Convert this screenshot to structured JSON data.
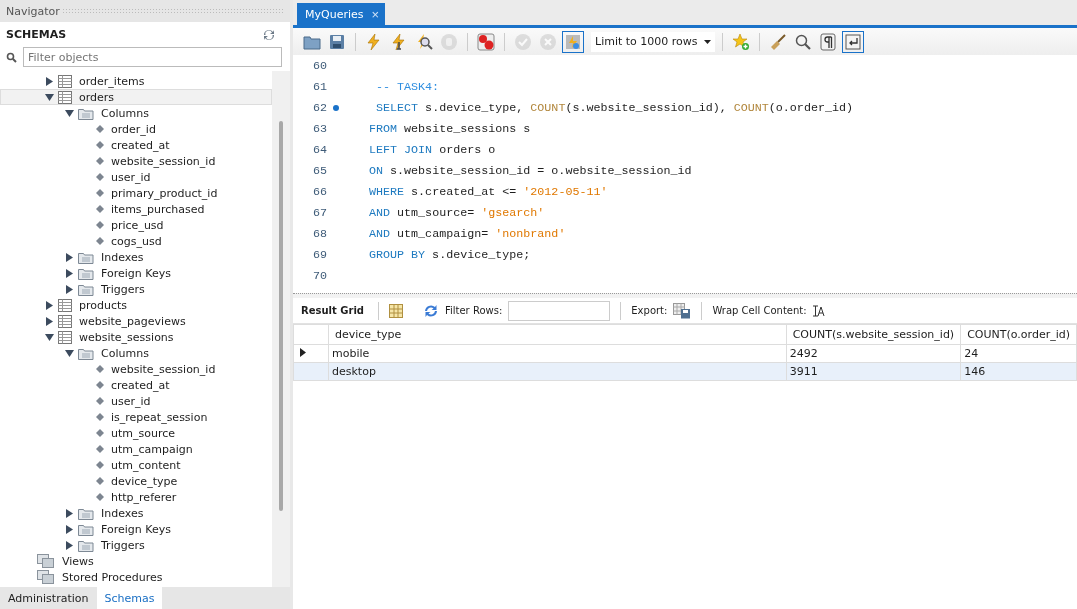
{
  "navigator": {
    "title": "Navigator",
    "section": "SCHEMAS",
    "filter": {
      "placeholder": "Filter objects"
    },
    "tree": [
      {
        "label": "order_items",
        "kind": "table",
        "expanded": false,
        "selected": false
      },
      {
        "label": "orders",
        "kind": "table",
        "expanded": true,
        "selected": true,
        "children": [
          {
            "label": "Columns",
            "kind": "folder",
            "expanded": true,
            "selected": false,
            "children": [
              {
                "label": "order_id",
                "kind": "column",
                "selected": false
              },
              {
                "label": "created_at",
                "kind": "column",
                "selected": false
              },
              {
                "label": "website_session_id",
                "kind": "column",
                "selected": false
              },
              {
                "label": "user_id",
                "kind": "column",
                "selected": false
              },
              {
                "label": "primary_product_id",
                "kind": "column",
                "selected": false
              },
              {
                "label": "items_purchased",
                "kind": "column",
                "selected": false
              },
              {
                "label": "price_usd",
                "kind": "column",
                "selected": false
              },
              {
                "label": "cogs_usd",
                "kind": "column",
                "selected": false
              }
            ]
          },
          {
            "label": "Indexes",
            "kind": "folder",
            "expanded": false,
            "selected": false
          },
          {
            "label": "Foreign Keys",
            "kind": "folder",
            "expanded": false,
            "selected": false
          },
          {
            "label": "Triggers",
            "kind": "folder",
            "expanded": false,
            "selected": false
          }
        ]
      },
      {
        "label": "products",
        "kind": "table",
        "expanded": false,
        "selected": false
      },
      {
        "label": "website_pageviews",
        "kind": "table",
        "expanded": false,
        "selected": false
      },
      {
        "label": "website_sessions",
        "kind": "table",
        "expanded": true,
        "selected": false,
        "children": [
          {
            "label": "Columns",
            "kind": "folder",
            "expanded": true,
            "selected": false,
            "children": [
              {
                "label": "website_session_id",
                "kind": "column",
                "selected": false
              },
              {
                "label": "created_at",
                "kind": "column",
                "selected": false
              },
              {
                "label": "user_id",
                "kind": "column",
                "selected": false
              },
              {
                "label": "is_repeat_session",
                "kind": "column",
                "selected": false
              },
              {
                "label": "utm_source",
                "kind": "column",
                "selected": false
              },
              {
                "label": "utm_campaign",
                "kind": "column",
                "selected": false
              },
              {
                "label": "utm_content",
                "kind": "column",
                "selected": false
              },
              {
                "label": "device_type",
                "kind": "column",
                "selected": false
              },
              {
                "label": "http_referer",
                "kind": "column",
                "selected": false
              }
            ]
          },
          {
            "label": "Indexes",
            "kind": "folder",
            "expanded": false,
            "selected": false
          },
          {
            "label": "Foreign Keys",
            "kind": "folder",
            "expanded": false,
            "selected": false
          },
          {
            "label": "Triggers",
            "kind": "folder",
            "expanded": false,
            "selected": false
          }
        ]
      },
      {
        "label": "Views",
        "kind": "group",
        "selected": false
      },
      {
        "label": "Stored Procedures",
        "kind": "group",
        "selected": false
      }
    ],
    "bottom_tabs": [
      {
        "label": "Administration",
        "selected": false
      },
      {
        "label": "Schemas",
        "selected": true
      }
    ]
  },
  "editor_tab": {
    "label": "MyQueries",
    "close": "×"
  },
  "toolbar": {
    "buttons": [
      {
        "on": false,
        "disabled": false
      },
      {
        "on": false,
        "disabled": false
      },
      {
        "on": false,
        "disabled": false
      },
      {
        "on": false,
        "disabled": false
      },
      {
        "on": false,
        "disabled": false
      },
      {
        "on": false,
        "disabled": true
      },
      {
        "on": false,
        "disabled": false
      },
      {
        "on": false,
        "disabled": true
      },
      {
        "on": false,
        "disabled": true
      },
      {
        "on": true,
        "disabled": false
      }
    ],
    "limit": "Limit to 1000 rows",
    "buttons_right": [
      {
        "on": false,
        "disabled": false
      },
      {
        "on": false,
        "disabled": false
      },
      {
        "on": false,
        "disabled": false
      },
      {
        "on": false,
        "disabled": false
      },
      {
        "on": true,
        "disabled": false
      }
    ]
  },
  "editor": {
    "lines": [
      {
        "number": "60",
        "marker": false
      },
      {
        "number": "61",
        "marker": false,
        "tokens": [
          {
            "kind": "comment",
            "text": " -- TASK4:"
          }
        ]
      },
      {
        "number": "62",
        "marker": true,
        "tokens": [
          {
            "kind": "keyword",
            "text": " SELECT"
          },
          {
            "kind": "plain",
            "text": " s.device_type, "
          },
          {
            "kind": "function",
            "text": "COUNT"
          },
          {
            "kind": "plain",
            "text": "(s.website_session_id), "
          },
          {
            "kind": "function",
            "text": "COUNT"
          },
          {
            "kind": "plain",
            "text": "(o.order_id)"
          }
        ]
      },
      {
        "number": "63",
        "marker": false,
        "tokens": [
          {
            "kind": "keyword",
            "text": "FROM"
          },
          {
            "kind": "plain",
            "text": " website_sessions s"
          }
        ]
      },
      {
        "number": "64",
        "marker": false,
        "tokens": [
          {
            "kind": "keyword",
            "text": "LEFT JOIN"
          },
          {
            "kind": "plain",
            "text": " orders o"
          }
        ]
      },
      {
        "number": "65",
        "marker": false,
        "tokens": [
          {
            "kind": "keyword",
            "text": "ON"
          },
          {
            "kind": "plain",
            "text": " s.website_session_id = o.website_session_id"
          }
        ]
      },
      {
        "number": "66",
        "marker": false,
        "tokens": [
          {
            "kind": "keyword",
            "text": "WHERE"
          },
          {
            "kind": "plain",
            "text": " s.created_at <= "
          },
          {
            "kind": "string",
            "text": "'2012-05-11'"
          }
        ]
      },
      {
        "number": "67",
        "marker": false,
        "tokens": [
          {
            "kind": "keyword",
            "text": "AND"
          },
          {
            "kind": "plain",
            "text": " utm_source= "
          },
          {
            "kind": "string",
            "text": "'gsearch'"
          }
        ]
      },
      {
        "number": "68",
        "marker": false,
        "tokens": [
          {
            "kind": "keyword",
            "text": "AND"
          },
          {
            "kind": "plain",
            "text": " utm_campaign= "
          },
          {
            "kind": "string",
            "text": "'nonbrand'"
          }
        ]
      },
      {
        "number": "69",
        "marker": false,
        "tokens": [
          {
            "kind": "keyword",
            "text": "GROUP BY"
          },
          {
            "kind": "plain",
            "text": " s.device_type;"
          }
        ]
      },
      {
        "number": "70",
        "marker": false
      }
    ]
  },
  "result": {
    "tab": "Result Grid",
    "filter_label": "Filter Rows:",
    "export_label": "Export:",
    "wrap_label": "Wrap Cell Content:",
    "columns": [
      "device_type",
      "COUNT(s.website_session_id)",
      "COUNT(o.order_id)"
    ],
    "rows": [
      {
        "cells": [
          "mobile",
          "2492",
          "24"
        ],
        "selected": true
      },
      {
        "cells": [
          "desktop",
          "3911",
          "146"
        ],
        "selected": false
      }
    ]
  }
}
